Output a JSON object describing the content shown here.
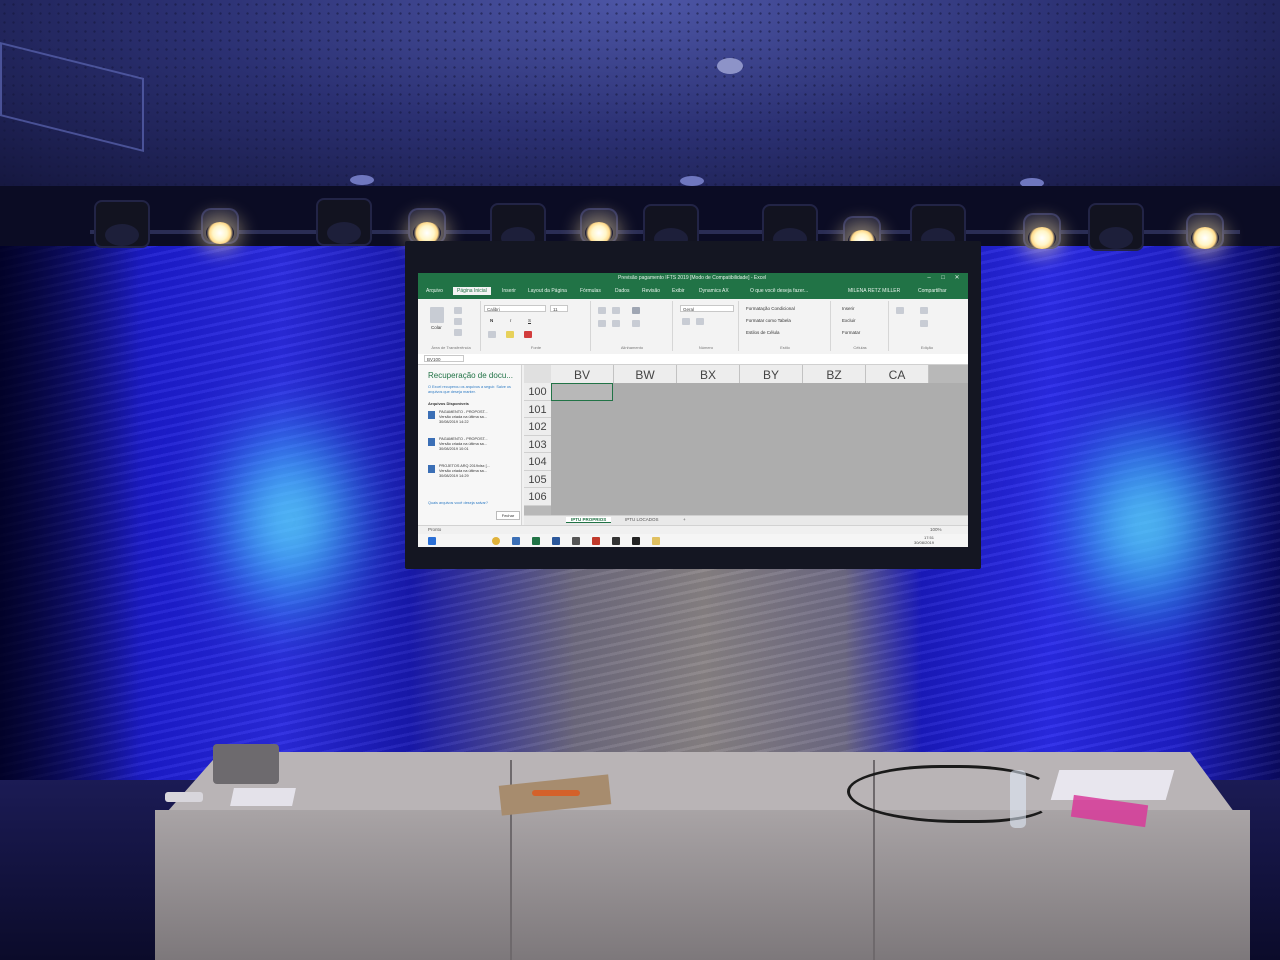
{
  "excel": {
    "window_title": "Previsão pagamento IFTS 2019 [Modo de Compatibilidade] - Excel",
    "window_controls": {
      "minimize": "–",
      "maximize": "□",
      "close": "✕"
    },
    "tabs": [
      "Arquivo",
      "Página Inicial",
      "Inserir",
      "Layout da Página",
      "Fórmulas",
      "Dados",
      "Revisão",
      "Exibir",
      "Dynamics AX"
    ],
    "active_tab": "Página Inicial",
    "tell_me": "O que você deseja fazer...",
    "user": "MILENA RETZ MILLER",
    "share": "Compartilhar",
    "ribbon": {
      "clipboard_caption": "Área de Transferência",
      "paste_label": "Colar",
      "font_name": "Calibri",
      "font_size": "11",
      "bold": "N",
      "italic": "I",
      "underline": "S",
      "font_caption": "Fonte",
      "alignment_caption": "Alinhamento",
      "number_format": "Geral",
      "number_caption": "Número",
      "conditional_formatting": "Formatação Condicional",
      "format_as_table": "Formatar como Tabela",
      "cell_styles": "Estilos de Célula",
      "styles_caption": "Estilo",
      "insert": "Inserir",
      "delete": "Excluir",
      "format": "Formatar",
      "cells_caption": "Células",
      "editing_caption": "Edição"
    },
    "name_box": "BV100",
    "recovery": {
      "title": "Recuperação de docu...",
      "description": "O Excel recuperou os arquivos a seguir. Salve os arquivos que deseja manter.",
      "available_label": "Arquivos Disponíveis",
      "files": [
        {
          "name": "PAGAMENTO - PROPOST...",
          "info": "Versão criada na última sa...",
          "date": "30/08/2019 14:22"
        },
        {
          "name": "PAGAMENTO - PROPOST...",
          "info": "Versão criada na última sa...",
          "date": "30/08/2019 10:01"
        },
        {
          "name": "PROJETOS ARQ 2019xlsx [...",
          "info": "Versão criada na última sa...",
          "date": "30/08/2019 14:29"
        }
      ],
      "question": "Quais arquivos você deseja salvar?",
      "close_button": "Fechar"
    },
    "columns": [
      "BV",
      "BW",
      "BX",
      "BY",
      "BZ",
      "CA"
    ],
    "rows": [
      "100",
      "101",
      "102",
      "103",
      "104",
      "105",
      "106"
    ],
    "sheet_tabs": [
      "IPTU PROPRIOS",
      "IPTU LOCADOS"
    ],
    "active_sheet": "IPTU PROPRIOS",
    "add_sheet": "+",
    "status": "Pronto",
    "zoom": "100%",
    "clock_time": "17:51",
    "clock_date": "30/08/2019"
  },
  "colors": {
    "excel_green": "#217346",
    "wall_blue": "#1f1fd6",
    "wash_cyan": "#6ff5ff",
    "spotlight_warm": "#fff3c8"
  },
  "icons": [
    "search-icon",
    "paste-icon",
    "sum-icon",
    "sort-icon",
    "find-icon",
    "windows-start-icon",
    "chrome-icon",
    "excel-icon",
    "outlook-icon"
  ]
}
